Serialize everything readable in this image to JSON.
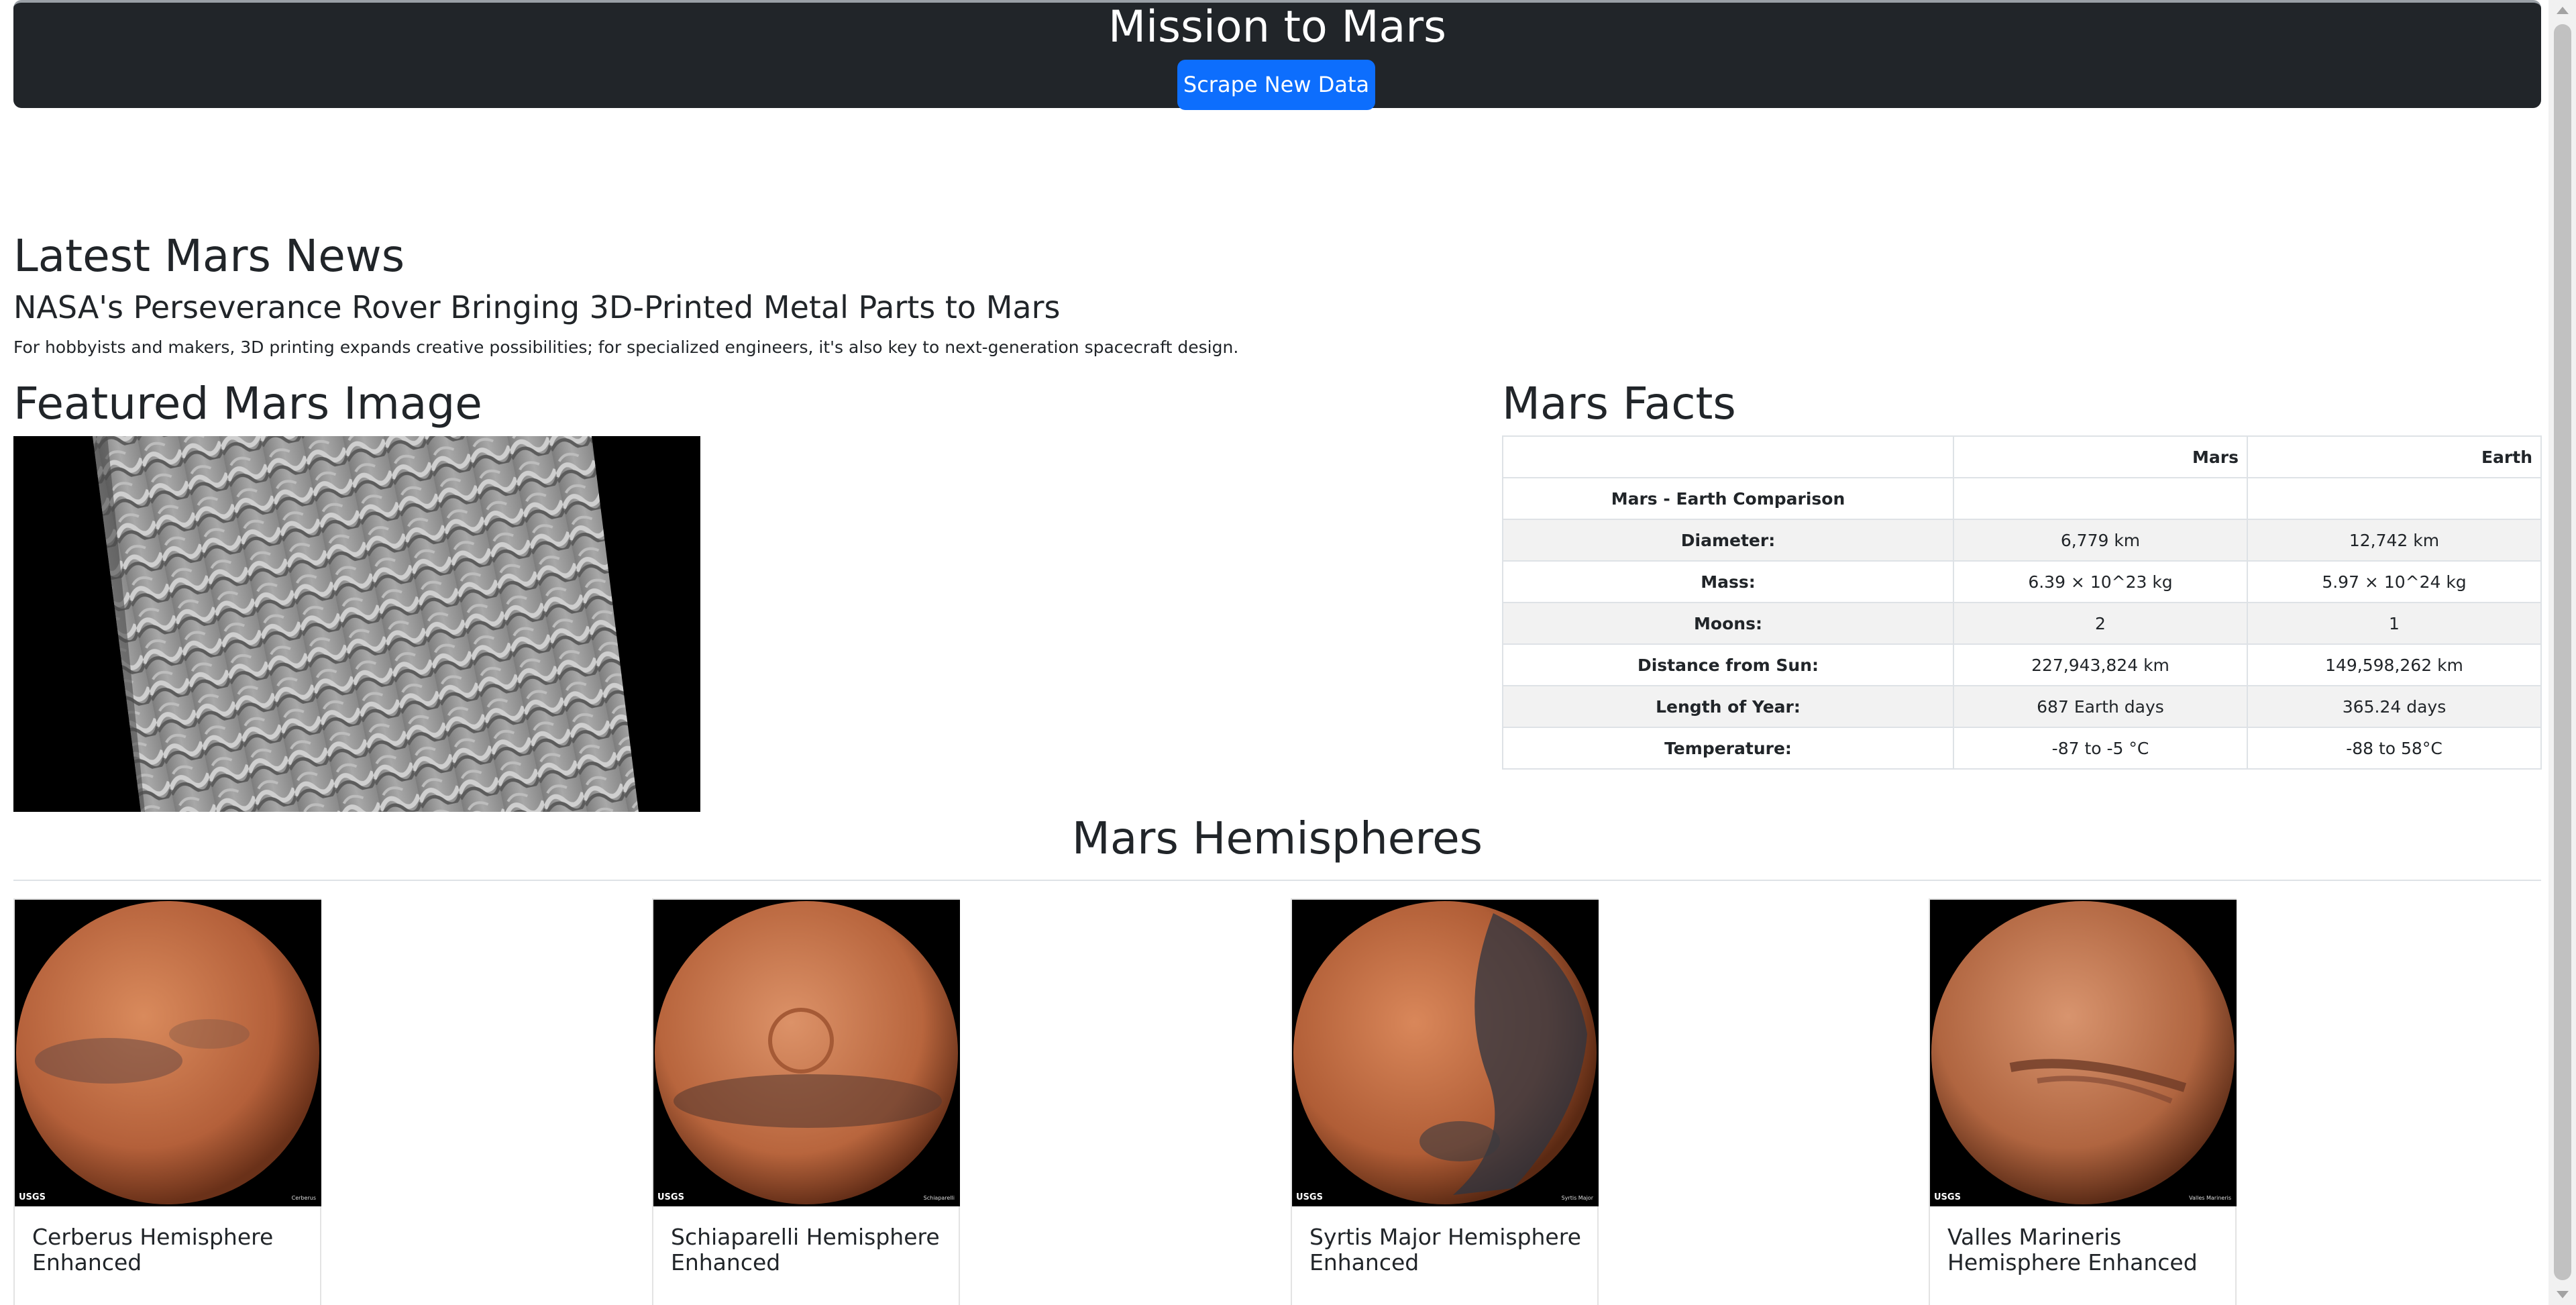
{
  "header": {
    "title": "Mission to Mars",
    "scrape_button": "Scrape New Data"
  },
  "news": {
    "heading": "Latest Mars News",
    "title": "NASA's Perseverance Rover Bringing 3D-Printed Metal Parts to Mars",
    "teaser": "For hobbyists and makers, 3D printing expands creative possibilities; for specialized engineers, it's also key to next-generation spacecraft design."
  },
  "featured": {
    "heading": "Featured Mars Image"
  },
  "facts": {
    "heading": "Mars Facts",
    "columns": [
      "",
      "Mars",
      "Earth"
    ],
    "comparison_label": "Mars - Earth Comparison",
    "rows": [
      {
        "label": "Diameter:",
        "mars": "6,779 km",
        "earth": "12,742 km"
      },
      {
        "label": "Mass:",
        "mars": "6.39 × 10^23 kg",
        "earth": "5.97 × 10^24 kg"
      },
      {
        "label": "Moons:",
        "mars": "2",
        "earth": "1"
      },
      {
        "label": "Distance from Sun:",
        "mars": "227,943,824 km",
        "earth": "149,598,262 km"
      },
      {
        "label": "Length of Year:",
        "mars": "687 Earth days",
        "earth": "365.24 days"
      },
      {
        "label": "Temperature:",
        "mars": "-87 to -5 °C",
        "earth": "-88 to 58°C"
      }
    ]
  },
  "hemispheres": {
    "heading": "Mars Hemispheres",
    "logo": "USGS",
    "items": [
      {
        "title": "Cerberus Hemisphere Enhanced",
        "corner": "Cerberus"
      },
      {
        "title": "Schiaparelli Hemisphere Enhanced",
        "corner": "Schiaparelli"
      },
      {
        "title": "Syrtis Major Hemisphere Enhanced",
        "corner": "Syrtis Major"
      },
      {
        "title": "Valles Marineris Hemisphere Enhanced",
        "corner": "Valles Marineris"
      }
    ]
  },
  "colors": {
    "header_bg": "#212529",
    "button_bg": "#0d6efd",
    "mars": "#c1663d"
  }
}
